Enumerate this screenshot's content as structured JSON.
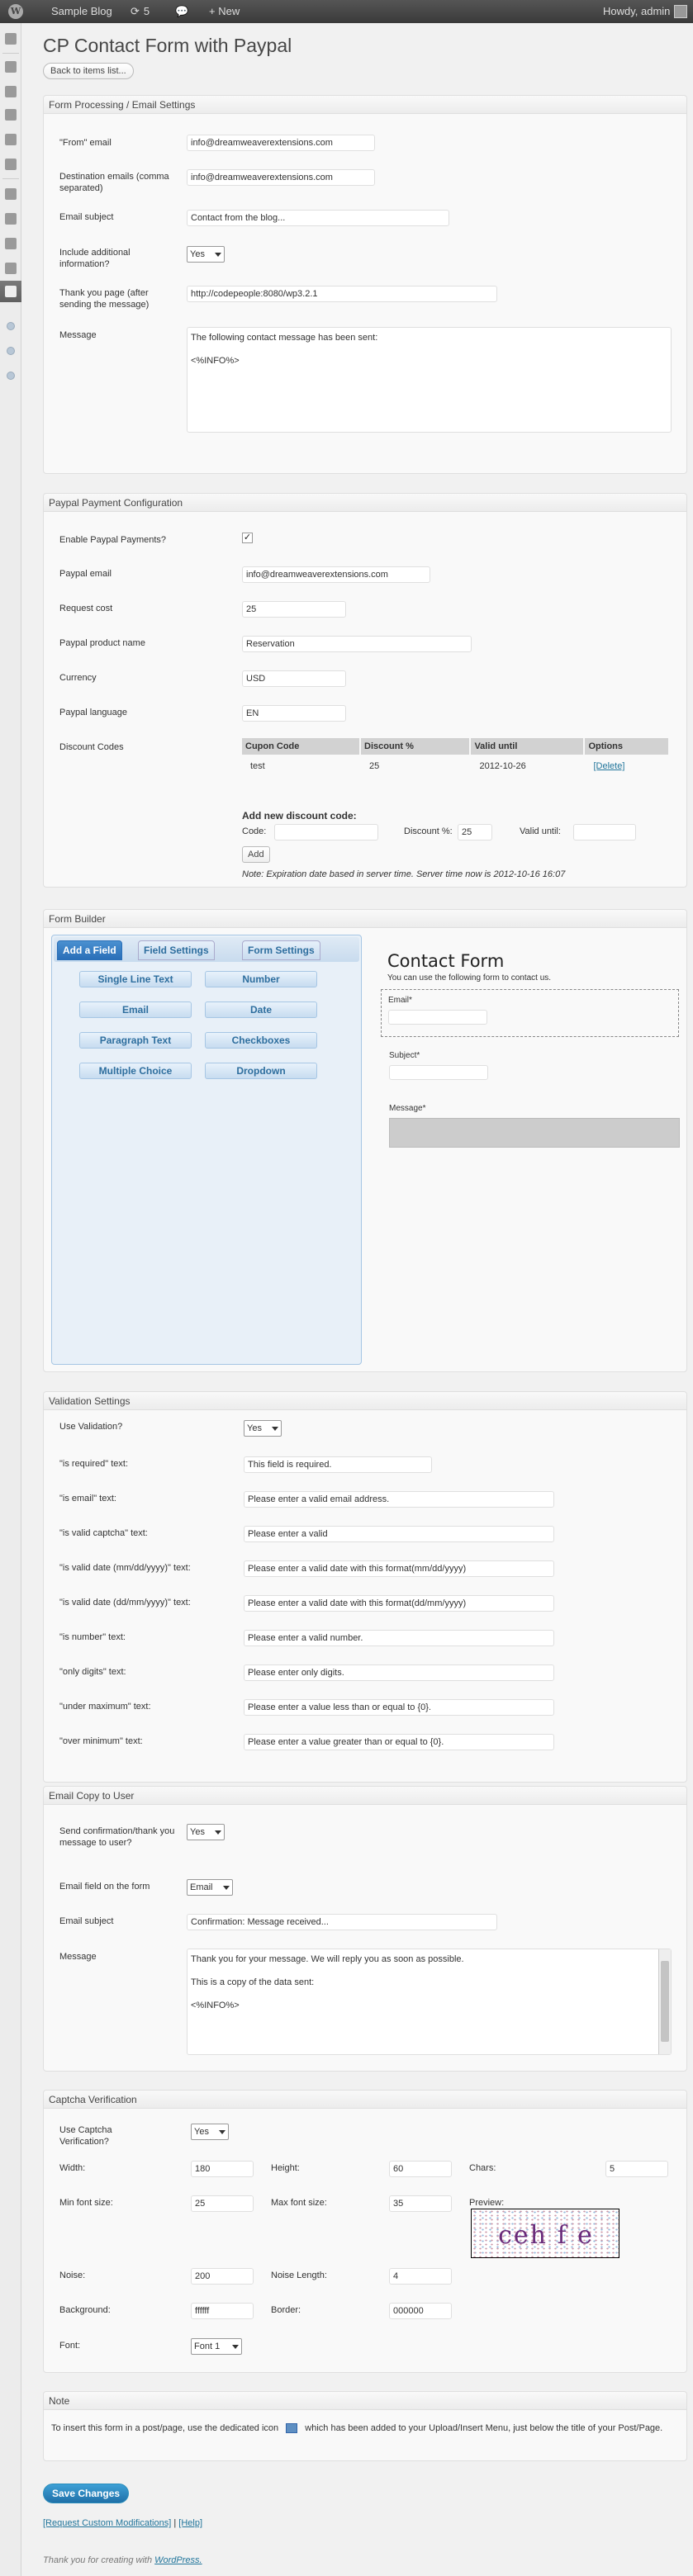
{
  "adminbar": {
    "site": "Sample Blog",
    "updates": "5",
    "new": "+ New",
    "howdy": "Howdy, admin"
  },
  "page": {
    "title": "CP Contact Form with Paypal",
    "back": "Back to items list..."
  },
  "s1": {
    "title": "Form Processing / Email Settings",
    "from_l": "\"From\" email",
    "from_v": "info@dreamweaverextensions.com",
    "dest_l": "Destination emails (comma separated)",
    "dest_v": "info@dreamweaverextensions.com",
    "subj_l": "Email subject",
    "subj_v": "Contact from the blog...",
    "incl_l": "Include additional information?",
    "incl_v": "Yes",
    "thanks_l": "Thank you page (after sending the message)",
    "thanks_v": "http://codepeople:8080/wp3.2.1",
    "msg_l": "Message",
    "msg_v": "The following contact message has been sent:\n\n<%INFO%>"
  },
  "s2": {
    "title": "Paypal Payment Configuration",
    "enable_l": "Enable Paypal Payments?",
    "enable_v": "✓",
    "email_l": "Paypal email",
    "email_v": "info@dreamweaverextensions.com",
    "cost_l": "Request cost",
    "cost_v": "25",
    "prod_l": "Paypal product name",
    "prod_v": "Reservation",
    "cur_l": "Currency",
    "cur_v": "USD",
    "lang_l": "Paypal language",
    "lang_v": "EN",
    "disc_l": "Discount Codes",
    "cols": [
      "Cupon Code",
      "Discount %",
      "Valid until",
      "Options"
    ],
    "row": [
      "test",
      "25",
      "2012-10-26",
      "[Delete]"
    ],
    "add_title": "Add new discount code:",
    "code_l": "Code:",
    "disc_pct_l": "Discount %:",
    "disc_pct_v": "25",
    "valid_l": "Valid until:",
    "add_btn": "Add",
    "note": "Note: Expiration date based in server time. Server time now is 2012-10-16 16:07"
  },
  "s3": {
    "title": "Form Builder",
    "tabs": [
      "Add a Field",
      "Field Settings",
      "Form Settings"
    ],
    "fields": [
      "Single Line Text",
      "Number",
      "Email",
      "Date",
      "Paragraph Text",
      "Checkboxes",
      "Multiple Choice",
      "Dropdown"
    ],
    "form_title": "Contact Form",
    "form_sub": "You can use the following form to contact us.",
    "f1": "Email*",
    "f2": "Subject*",
    "f3": "Message*"
  },
  "s4": {
    "title": "Validation Settings",
    "use_l": "Use Validation?",
    "use_v": "Yes",
    "rows": [
      {
        "l": "\"is required\" text:",
        "v": "This field is required."
      },
      {
        "l": "\"is email\" text:",
        "v": "Please enter a valid email address."
      },
      {
        "l": "\"is valid captcha\" text:",
        "v": "Please enter a valid"
      },
      {
        "l": "\"is valid date (mm/dd/yyyy)\" text:",
        "v": "Please enter a valid date with this format(mm/dd/yyyy)"
      },
      {
        "l": "\"is valid date (dd/mm/yyyy)\" text:",
        "v": "Please enter a valid date with this format(dd/mm/yyyy)"
      },
      {
        "l": "\"is number\" text:",
        "v": "Please enter a valid number."
      },
      {
        "l": "\"only digits\" text:",
        "v": "Please enter only digits."
      },
      {
        "l": "\"under maximum\" text:",
        "v": "Please enter a value less than or equal to {0}."
      },
      {
        "l": "\"over minimum\" text:",
        "v": "Please enter a value greater than or equal to {0}."
      }
    ]
  },
  "s5": {
    "title": "Email Copy to User",
    "send_l": "Send confirmation/thank you message to user?",
    "send_v": "Yes",
    "field_l": "Email field on the form",
    "field_v": "Email",
    "subj_l": "Email subject",
    "subj_v": "Confirmation: Message received...",
    "msg_l": "Message",
    "msg_v": "Thank you for your message. We will reply you as soon as possible.\n\nThis is a copy of the data sent:\n\n<%INFO%>"
  },
  "s6": {
    "title": "Captcha Verification",
    "use_l": "Use Captcha Verification?",
    "use_v": "Yes",
    "width_l": "Width:",
    "width_v": "180",
    "height_l": "Height:",
    "height_v": "60",
    "chars_l": "Chars:",
    "chars_v": "5",
    "minf_l": "Min font size:",
    "minf_v": "25",
    "maxf_l": "Max font size:",
    "maxf_v": "35",
    "preview_l": "Preview:",
    "captcha": "ceh f e",
    "noise_l": "Noise:",
    "noise_v": "200",
    "nlen_l": "Noise Length:",
    "nlen_v": "4",
    "bg_l": "Background:",
    "bg_v": "ffffff",
    "border_l": "Border:",
    "border_v": "000000",
    "font_l": "Font:",
    "font_v": "Font 1"
  },
  "s7": {
    "title": "Note",
    "text_a": "To insert this form in a post/page, use the dedicated icon",
    "text_b": "which has been added to your Upload/Insert Menu, just below the title of your Post/Page."
  },
  "footer": {
    "save": "Save Changes",
    "custom": "[Request Custom Modifications]",
    "sep": " | ",
    "help": "[Help]",
    "thanks": "Thank you for creating with",
    "wp": "WordPress."
  }
}
